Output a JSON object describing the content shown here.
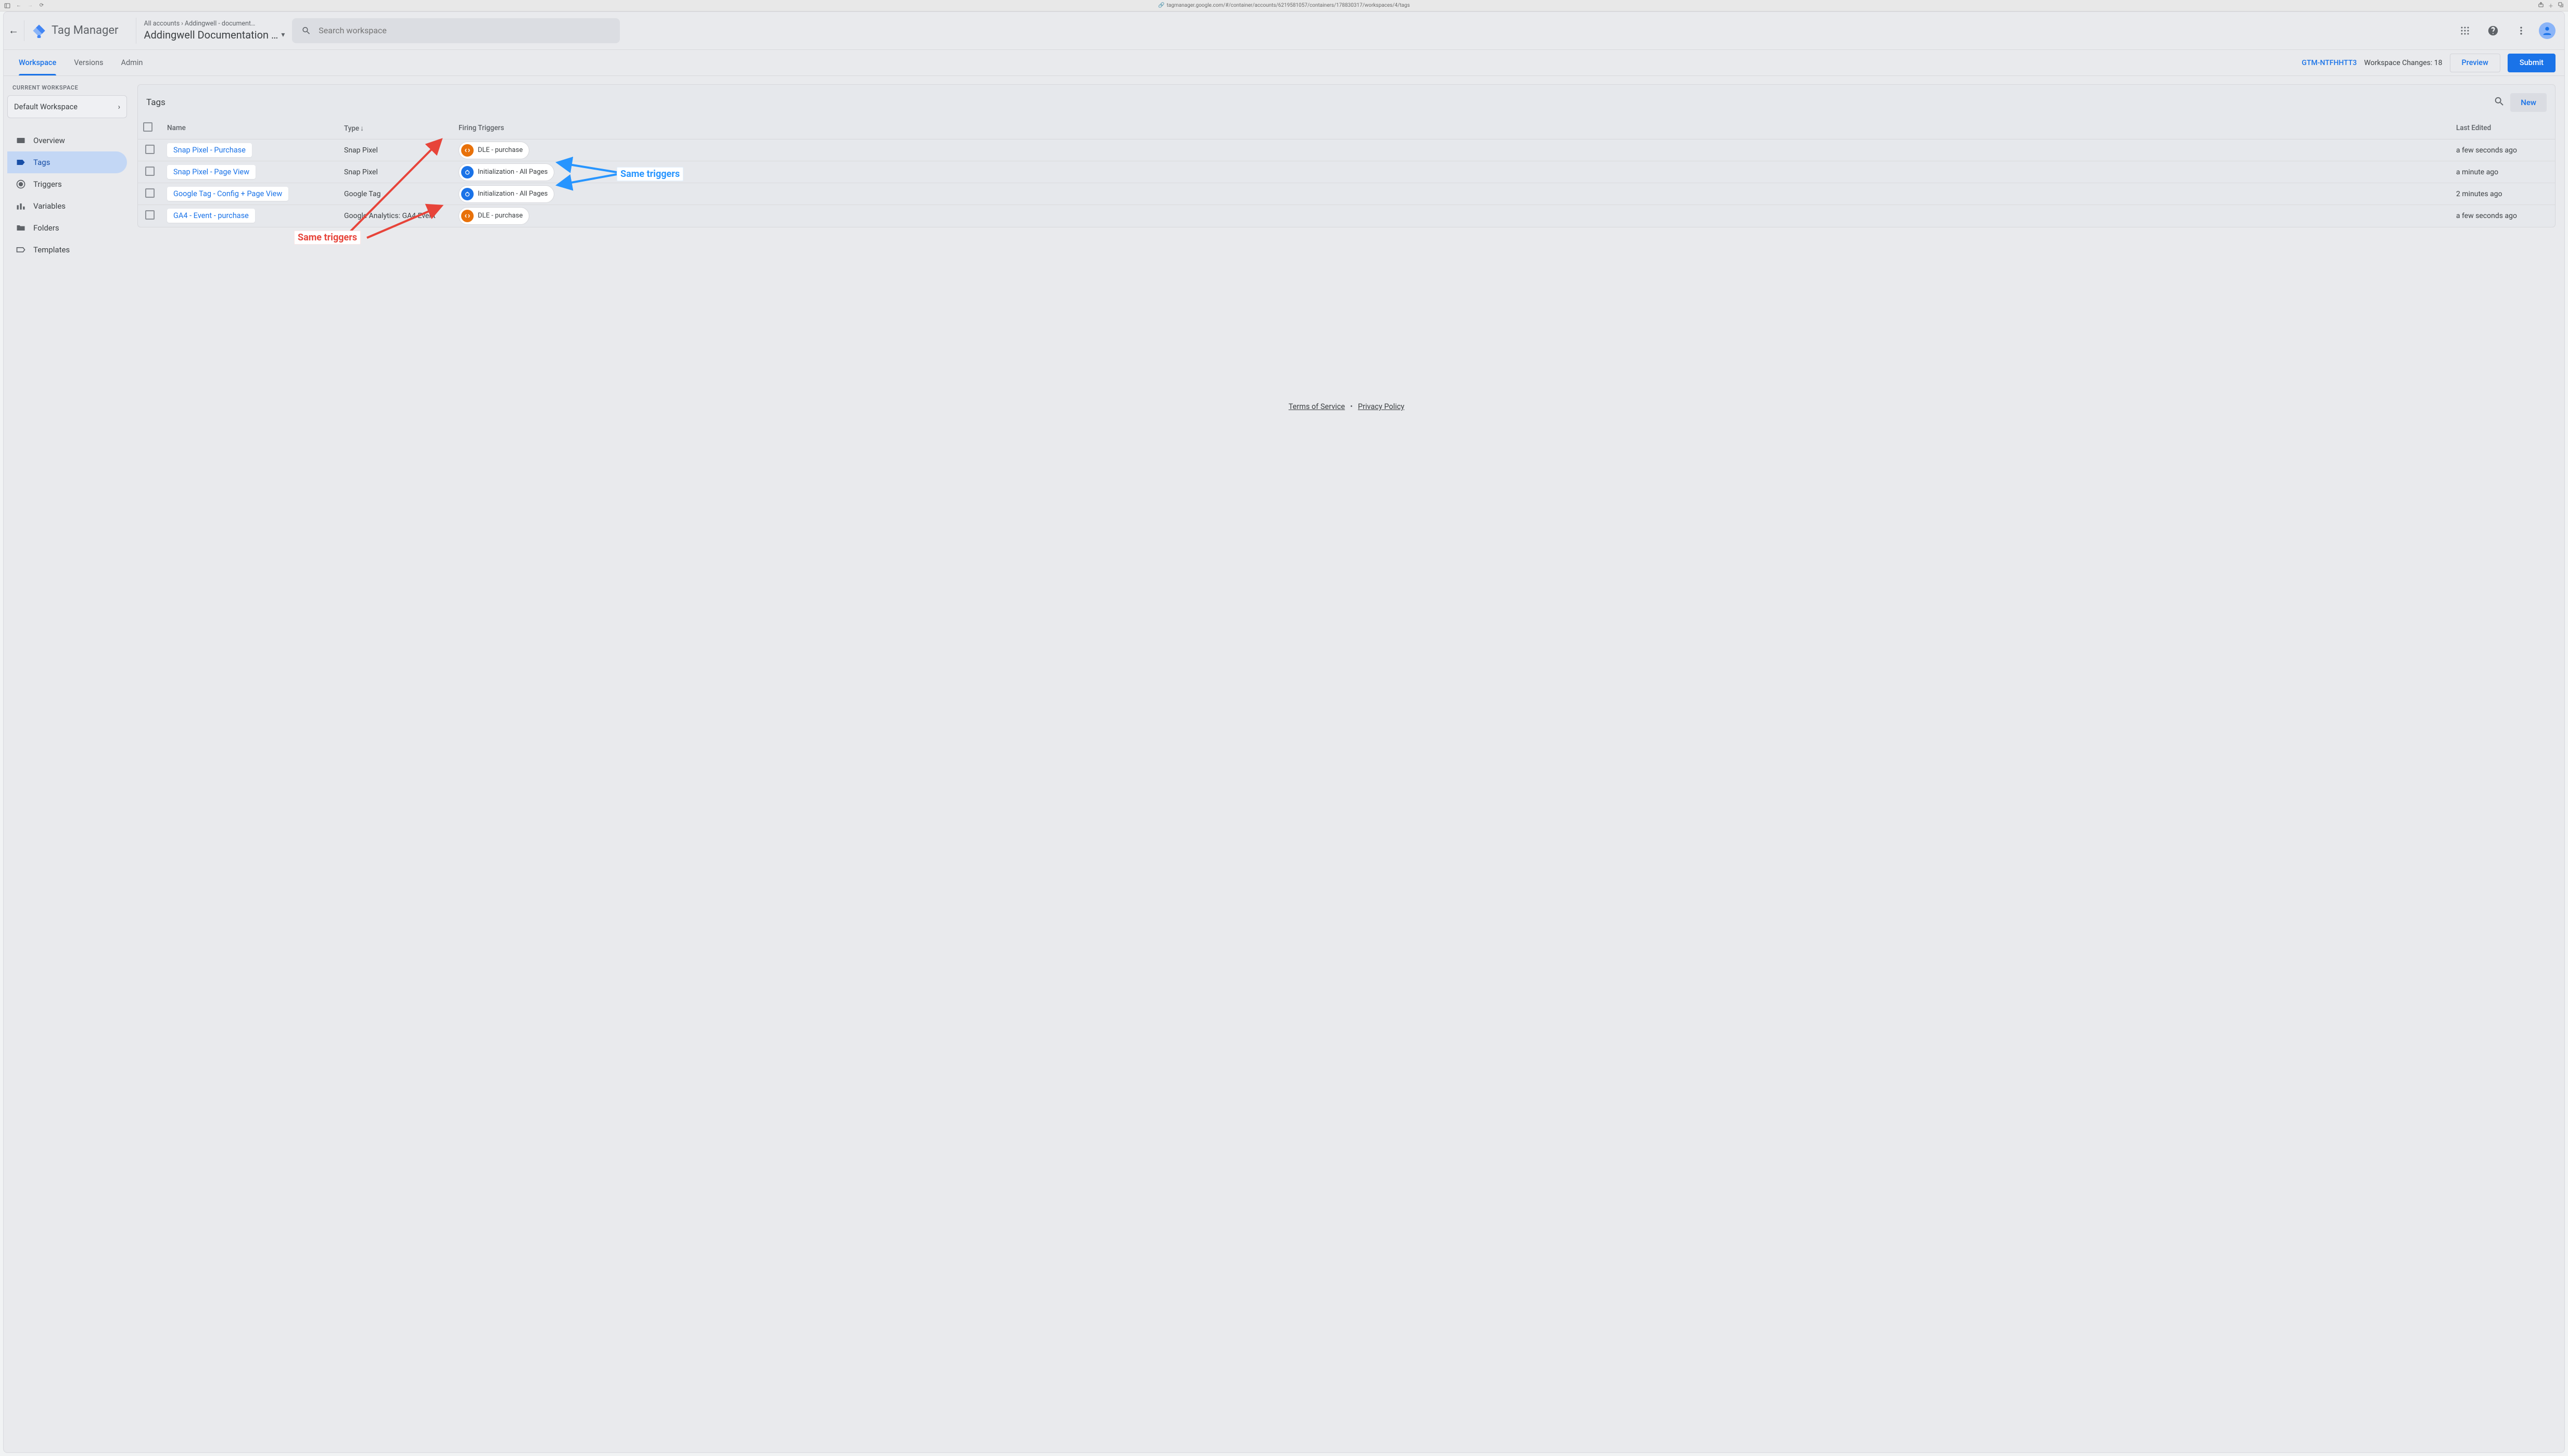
{
  "browser": {
    "url": "tagmanager.google.com/#/container/accounts/6219581057/containers/178830317/workspaces/4/tags"
  },
  "header": {
    "product": "Tag Manager",
    "breadcrumb_accounts": "All accounts",
    "breadcrumb_container": "Addingwell - document…",
    "container_name": "Addingwell Documentation …",
    "search_placeholder": "Search workspace"
  },
  "nav": {
    "items": [
      "Workspace",
      "Versions",
      "Admin"
    ],
    "active_index": 0,
    "container_id": "GTM-NTFHHTT3",
    "changes_text": "Workspace Changes: 18",
    "preview_label": "Preview",
    "submit_label": "Submit"
  },
  "sidebar": {
    "current_workspace_label": "CURRENT WORKSPACE",
    "workspace_name": "Default Workspace",
    "items": [
      "Overview",
      "Tags",
      "Triggers",
      "Variables",
      "Folders",
      "Templates"
    ],
    "active_index": 1
  },
  "tags_panel": {
    "title": "Tags",
    "new_label": "New",
    "columns": {
      "name": "Name",
      "type": "Type",
      "firing": "Firing Triggers",
      "last_edited": "Last Edited"
    },
    "rows": [
      {
        "name": "Snap Pixel - Purchase",
        "type": "Snap Pixel",
        "trigger": {
          "kind": "orange",
          "label": "DLE - purchase"
        },
        "last_edited": "a few seconds ago"
      },
      {
        "name": "Snap Pixel - Page View",
        "type": "Snap Pixel",
        "trigger": {
          "kind": "blue",
          "label": "Initialization - All Pages"
        },
        "last_edited": "a minute ago"
      },
      {
        "name": "Google Tag - Config + Page View",
        "type": "Google Tag",
        "trigger": {
          "kind": "blue",
          "label": "Initialization - All Pages"
        },
        "last_edited": "2 minutes ago"
      },
      {
        "name": "GA4 - Event - purchase",
        "type": "Google Analytics: GA4 Event",
        "trigger": {
          "kind": "orange",
          "label": "DLE - purchase"
        },
        "last_edited": "a few seconds ago"
      }
    ]
  },
  "annotations": {
    "red_label": "Same triggers",
    "blue_label": "Same triggers"
  },
  "footer": {
    "tos": "Terms of Service",
    "pp": "Privacy Policy"
  }
}
